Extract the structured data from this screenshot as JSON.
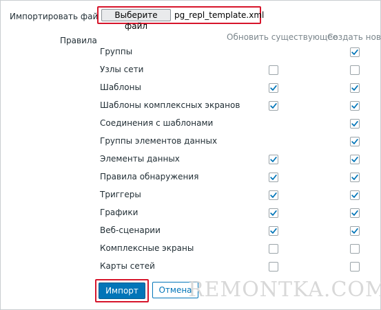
{
  "import_file": {
    "label": "Импортировать файл",
    "choose_button": "Выберите файл",
    "file_name": "pg_repl_template.xml"
  },
  "rules": {
    "label": "Правила",
    "col_update": "Обновить существующее",
    "col_create": "Создать новые",
    "rows": [
      {
        "label": "Группы",
        "update": null,
        "create": true
      },
      {
        "label": "Узлы сети",
        "update": false,
        "create": false
      },
      {
        "label": "Шаблоны",
        "update": true,
        "create": true
      },
      {
        "label": "Шаблоны комплексных экранов",
        "update": true,
        "create": true
      },
      {
        "label": "Соединения с шаблонами",
        "update": null,
        "create": true
      },
      {
        "label": "Группы элементов данных",
        "update": null,
        "create": true
      },
      {
        "label": "Элементы данных",
        "update": true,
        "create": true
      },
      {
        "label": "Правила обнаружения",
        "update": true,
        "create": true
      },
      {
        "label": "Триггеры",
        "update": true,
        "create": true
      },
      {
        "label": "Графики",
        "update": true,
        "create": true
      },
      {
        "label": "Веб-сценарии",
        "update": true,
        "create": true
      },
      {
        "label": "Комплексные экраны",
        "update": false,
        "create": false
      },
      {
        "label": "Карты сетей",
        "update": false,
        "create": false
      }
    ]
  },
  "actions": {
    "import_button": "Импорт",
    "cancel_button": "Отмена"
  },
  "watermark": "REMONTKA.COM",
  "colors": {
    "primary": "#0275b8",
    "highlight_border": "#d6142a",
    "check": "#0275b8"
  }
}
